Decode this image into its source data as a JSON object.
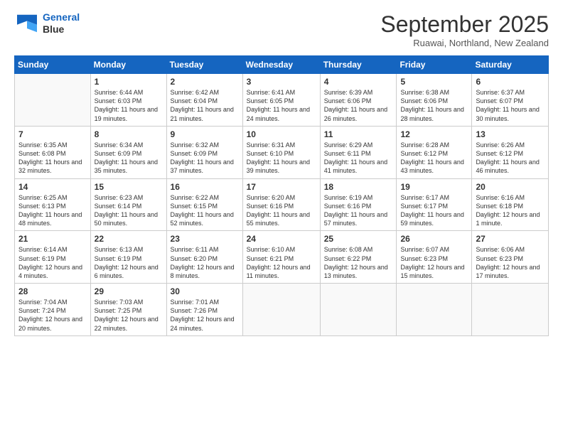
{
  "header": {
    "logo_line1": "General",
    "logo_line2": "Blue",
    "month": "September 2025",
    "location": "Ruawai, Northland, New Zealand"
  },
  "weekdays": [
    "Sunday",
    "Monday",
    "Tuesday",
    "Wednesday",
    "Thursday",
    "Friday",
    "Saturday"
  ],
  "weeks": [
    [
      {
        "day": "",
        "info": ""
      },
      {
        "day": "1",
        "info": "Sunrise: 6:44 AM\nSunset: 6:03 PM\nDaylight: 11 hours\nand 19 minutes."
      },
      {
        "day": "2",
        "info": "Sunrise: 6:42 AM\nSunset: 6:04 PM\nDaylight: 11 hours\nand 21 minutes."
      },
      {
        "day": "3",
        "info": "Sunrise: 6:41 AM\nSunset: 6:05 PM\nDaylight: 11 hours\nand 24 minutes."
      },
      {
        "day": "4",
        "info": "Sunrise: 6:39 AM\nSunset: 6:06 PM\nDaylight: 11 hours\nand 26 minutes."
      },
      {
        "day": "5",
        "info": "Sunrise: 6:38 AM\nSunset: 6:06 PM\nDaylight: 11 hours\nand 28 minutes."
      },
      {
        "day": "6",
        "info": "Sunrise: 6:37 AM\nSunset: 6:07 PM\nDaylight: 11 hours\nand 30 minutes."
      }
    ],
    [
      {
        "day": "7",
        "info": "Sunrise: 6:35 AM\nSunset: 6:08 PM\nDaylight: 11 hours\nand 32 minutes."
      },
      {
        "day": "8",
        "info": "Sunrise: 6:34 AM\nSunset: 6:09 PM\nDaylight: 11 hours\nand 35 minutes."
      },
      {
        "day": "9",
        "info": "Sunrise: 6:32 AM\nSunset: 6:09 PM\nDaylight: 11 hours\nand 37 minutes."
      },
      {
        "day": "10",
        "info": "Sunrise: 6:31 AM\nSunset: 6:10 PM\nDaylight: 11 hours\nand 39 minutes."
      },
      {
        "day": "11",
        "info": "Sunrise: 6:29 AM\nSunset: 6:11 PM\nDaylight: 11 hours\nand 41 minutes."
      },
      {
        "day": "12",
        "info": "Sunrise: 6:28 AM\nSunset: 6:12 PM\nDaylight: 11 hours\nand 43 minutes."
      },
      {
        "day": "13",
        "info": "Sunrise: 6:26 AM\nSunset: 6:12 PM\nDaylight: 11 hours\nand 46 minutes."
      }
    ],
    [
      {
        "day": "14",
        "info": "Sunrise: 6:25 AM\nSunset: 6:13 PM\nDaylight: 11 hours\nand 48 minutes."
      },
      {
        "day": "15",
        "info": "Sunrise: 6:23 AM\nSunset: 6:14 PM\nDaylight: 11 hours\nand 50 minutes."
      },
      {
        "day": "16",
        "info": "Sunrise: 6:22 AM\nSunset: 6:15 PM\nDaylight: 11 hours\nand 52 minutes."
      },
      {
        "day": "17",
        "info": "Sunrise: 6:20 AM\nSunset: 6:16 PM\nDaylight: 11 hours\nand 55 minutes."
      },
      {
        "day": "18",
        "info": "Sunrise: 6:19 AM\nSunset: 6:16 PM\nDaylight: 11 hours\nand 57 minutes."
      },
      {
        "day": "19",
        "info": "Sunrise: 6:17 AM\nSunset: 6:17 PM\nDaylight: 11 hours\nand 59 minutes."
      },
      {
        "day": "20",
        "info": "Sunrise: 6:16 AM\nSunset: 6:18 PM\nDaylight: 12 hours\nand 1 minute."
      }
    ],
    [
      {
        "day": "21",
        "info": "Sunrise: 6:14 AM\nSunset: 6:19 PM\nDaylight: 12 hours\nand 4 minutes."
      },
      {
        "day": "22",
        "info": "Sunrise: 6:13 AM\nSunset: 6:19 PM\nDaylight: 12 hours\nand 6 minutes."
      },
      {
        "day": "23",
        "info": "Sunrise: 6:11 AM\nSunset: 6:20 PM\nDaylight: 12 hours\nand 8 minutes."
      },
      {
        "day": "24",
        "info": "Sunrise: 6:10 AM\nSunset: 6:21 PM\nDaylight: 12 hours\nand 11 minutes."
      },
      {
        "day": "25",
        "info": "Sunrise: 6:08 AM\nSunset: 6:22 PM\nDaylight: 12 hours\nand 13 minutes."
      },
      {
        "day": "26",
        "info": "Sunrise: 6:07 AM\nSunset: 6:23 PM\nDaylight: 12 hours\nand 15 minutes."
      },
      {
        "day": "27",
        "info": "Sunrise: 6:06 AM\nSunset: 6:23 PM\nDaylight: 12 hours\nand 17 minutes."
      }
    ],
    [
      {
        "day": "28",
        "info": "Sunrise: 7:04 AM\nSunset: 7:24 PM\nDaylight: 12 hours\nand 20 minutes."
      },
      {
        "day": "29",
        "info": "Sunrise: 7:03 AM\nSunset: 7:25 PM\nDaylight: 12 hours\nand 22 minutes."
      },
      {
        "day": "30",
        "info": "Sunrise: 7:01 AM\nSunset: 7:26 PM\nDaylight: 12 hours\nand 24 minutes."
      },
      {
        "day": "",
        "info": ""
      },
      {
        "day": "",
        "info": ""
      },
      {
        "day": "",
        "info": ""
      },
      {
        "day": "",
        "info": ""
      }
    ]
  ]
}
